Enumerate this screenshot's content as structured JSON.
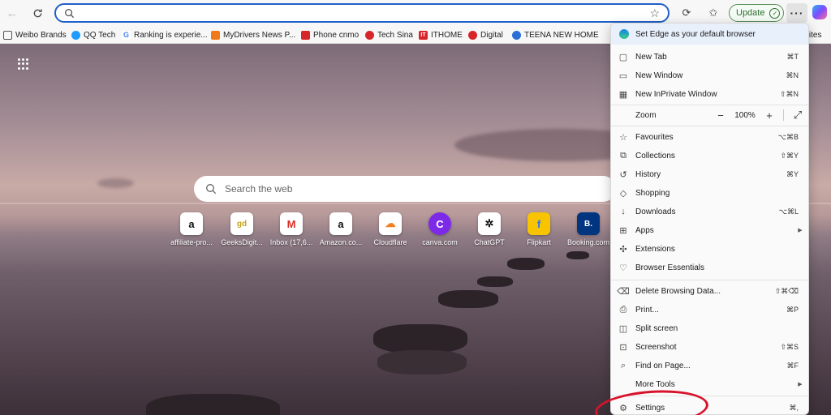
{
  "toolbar": {
    "update_label": "Update",
    "address_value": ""
  },
  "favourites": [
    {
      "label": "Weibo Brands",
      "icon": "folder-icon",
      "color": "#777777"
    },
    {
      "label": "QQ Tech",
      "icon": "qq-icon",
      "color": "#1e9bff"
    },
    {
      "label": "Ranking is experie...",
      "icon": "google-icon",
      "color": "#4285f4"
    },
    {
      "label": "MyDrivers News P...",
      "icon": "mydrivers-icon",
      "color": "#f07a1a"
    },
    {
      "label": "Phone cnmo",
      "icon": "cnmo-icon",
      "color": "#d6262a"
    },
    {
      "label": "Tech Sina",
      "icon": "sina-icon",
      "color": "#d6262a"
    },
    {
      "label": "ITHOME",
      "icon": "ithome-icon",
      "color": "#d6262a"
    },
    {
      "label": "Digital",
      "icon": "sina-icon",
      "color": "#d6262a"
    },
    {
      "label": "TEENA NEW HOME",
      "icon": "teena-icon",
      "color": "#2a6fd6"
    }
  ],
  "favourites_more": "urites",
  "newtab": {
    "search_placeholder": "Search the web",
    "tiles": [
      {
        "label": "affiliate-pro...",
        "glyph": "a",
        "color": "#111111"
      },
      {
        "label": "GeeksDigit...",
        "glyph": "gd",
        "color": "#c9a21a"
      },
      {
        "label": "Inbox (17,6...",
        "glyph": "M",
        "color": "#d93025"
      },
      {
        "label": "Amazon.co...",
        "glyph": "a",
        "color": "#111111"
      },
      {
        "label": "Cloudflare",
        "glyph": "☁",
        "color": "#f38020"
      },
      {
        "label": "canva.com",
        "glyph": "C",
        "color": "#7d2ae8"
      },
      {
        "label": "ChatGPT",
        "glyph": "✲",
        "color": "#111111"
      },
      {
        "label": "Flipkart",
        "glyph": "f",
        "color": "#f8c400"
      },
      {
        "label": "Booking.com",
        "glyph": "B.",
        "color": "#003580"
      }
    ]
  },
  "menu": {
    "promo": "Set Edge as your default browser",
    "items": [
      {
        "label": "New Tab",
        "shortcut": "⌘T",
        "icon": "new-tab-icon",
        "glyph": "▢"
      },
      {
        "label": "New Window",
        "shortcut": "⌘N",
        "icon": "new-window-icon",
        "glyph": "▭"
      },
      {
        "label": "New InPrivate Window",
        "shortcut": "⇧⌘N",
        "icon": "inprivate-icon",
        "glyph": "▦"
      },
      {
        "label": "Zoom",
        "shortcut": "",
        "icon": "",
        "glyph": ""
      },
      {
        "label": "Favourites",
        "shortcut": "⌥⌘B",
        "icon": "favourites-icon",
        "glyph": "☆"
      },
      {
        "label": "Collections",
        "shortcut": "⇧⌘Y",
        "icon": "collections-icon",
        "glyph": "⧉"
      },
      {
        "label": "History",
        "shortcut": "⌘Y",
        "icon": "history-icon",
        "glyph": "↺"
      },
      {
        "label": "Shopping",
        "shortcut": "",
        "icon": "shopping-icon",
        "glyph": "◇"
      },
      {
        "label": "Downloads",
        "shortcut": "⌥⌘L",
        "icon": "downloads-icon",
        "glyph": "↓"
      },
      {
        "label": "Apps",
        "shortcut": "",
        "icon": "apps-icon",
        "glyph": "⊞"
      },
      {
        "label": "Extensions",
        "shortcut": "",
        "icon": "extensions-icon",
        "glyph": "✣"
      },
      {
        "label": "Browser Essentials",
        "shortcut": "",
        "icon": "browser-essentials-icon",
        "glyph": "♡"
      },
      {
        "label": "Delete Browsing Data...",
        "shortcut": "⇧⌘⌫",
        "icon": "delete-icon",
        "glyph": "🗑"
      },
      {
        "label": "Print...",
        "shortcut": "⌘P",
        "icon": "print-icon",
        "glyph": "⎙"
      },
      {
        "label": "Split screen",
        "shortcut": "",
        "icon": "split-screen-icon",
        "glyph": "◫"
      },
      {
        "label": "Screenshot",
        "shortcut": "⇧⌘S",
        "icon": "screenshot-icon",
        "glyph": "⊡"
      },
      {
        "label": "Find on Page...",
        "shortcut": "⌘F",
        "icon": "find-icon",
        "glyph": "⌕"
      },
      {
        "label": "More Tools",
        "shortcut": "",
        "icon": "",
        "glyph": ""
      },
      {
        "label": "Settings",
        "shortcut": "⌘,",
        "icon": "settings-icon",
        "glyph": "⚙"
      }
    ],
    "zoom_value": "100%",
    "zoom_minus": "−",
    "zoom_plus": "+"
  }
}
